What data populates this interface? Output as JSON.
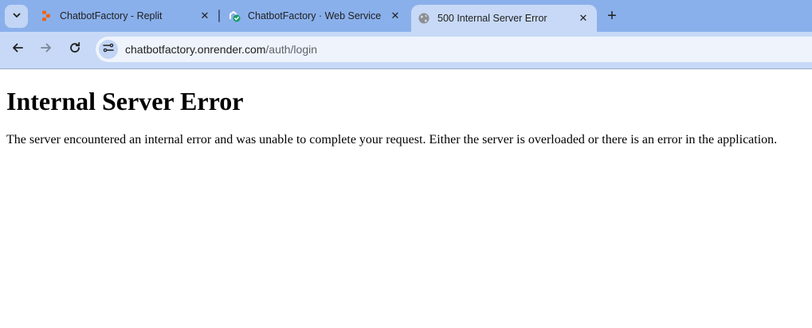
{
  "browser": {
    "tabs": [
      {
        "title": "ChatbotFactory - Replit",
        "favicon": "replit-icon",
        "active": false
      },
      {
        "title": "ChatbotFactory · Web Service",
        "favicon": "render-service-icon",
        "active": false
      },
      {
        "title": "500 Internal Server Error",
        "favicon": "globe-icon",
        "active": true
      }
    ],
    "tab_search_icon": "chevron-down-icon",
    "close_glyph": "✕",
    "new_tab_glyph": "+",
    "url_host": "chatbotfactory.onrender.com",
    "url_path": "/auth/login"
  },
  "page": {
    "heading": "Internal Server Error",
    "message": "The server encountered an internal error and was unable to complete your request. Either the server is overloaded or there is an error in the application."
  },
  "colors": {
    "tabstrip": "#8ab0ec",
    "toolbar": "#c7d9f6",
    "replit_orange": "#f26207",
    "render_green": "#1a9d6b"
  }
}
